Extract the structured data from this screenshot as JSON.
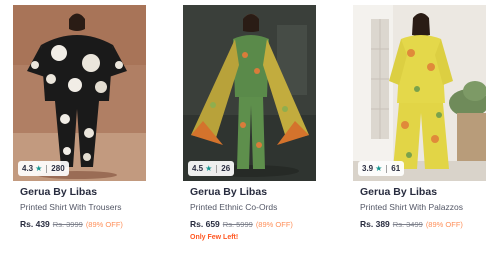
{
  "products": [
    {
      "image_alt": "Woman in black floral printed shirt and trousers",
      "rating": "4.3",
      "rating_count": "280",
      "brand": "Gerua By Libas",
      "title": "Printed Shirt With Trousers",
      "price": "Rs. 439",
      "mrp": "Rs. 3999",
      "discount": "(89% OFF)",
      "alert": ""
    },
    {
      "image_alt": "Woman in green and yellow printed ethnic co-ords",
      "rating": "4.5",
      "rating_count": "26",
      "brand": "Gerua By Libas",
      "title": "Printed Ethnic Co-Ords",
      "price": "Rs. 659",
      "mrp": "Rs. 5999",
      "discount": "(89% OFF)",
      "alert": "Only Few Left!"
    },
    {
      "image_alt": "Woman in yellow printed shirt with palazzos",
      "rating": "3.9",
      "rating_count": "61",
      "brand": "Gerua By Libas",
      "title": "Printed Shirt With Palazzos",
      "price": "Rs. 389",
      "mrp": "Rs. 3499",
      "discount": "(89% OFF)",
      "alert": ""
    }
  ],
  "icons": {
    "rating_star": "star-icon"
  },
  "colors": {
    "rating_star": "#14958f",
    "discount": "#ff905a",
    "alert": "#ff5722",
    "brand_text": "#282c3f",
    "muted_text": "#7e818c"
  }
}
